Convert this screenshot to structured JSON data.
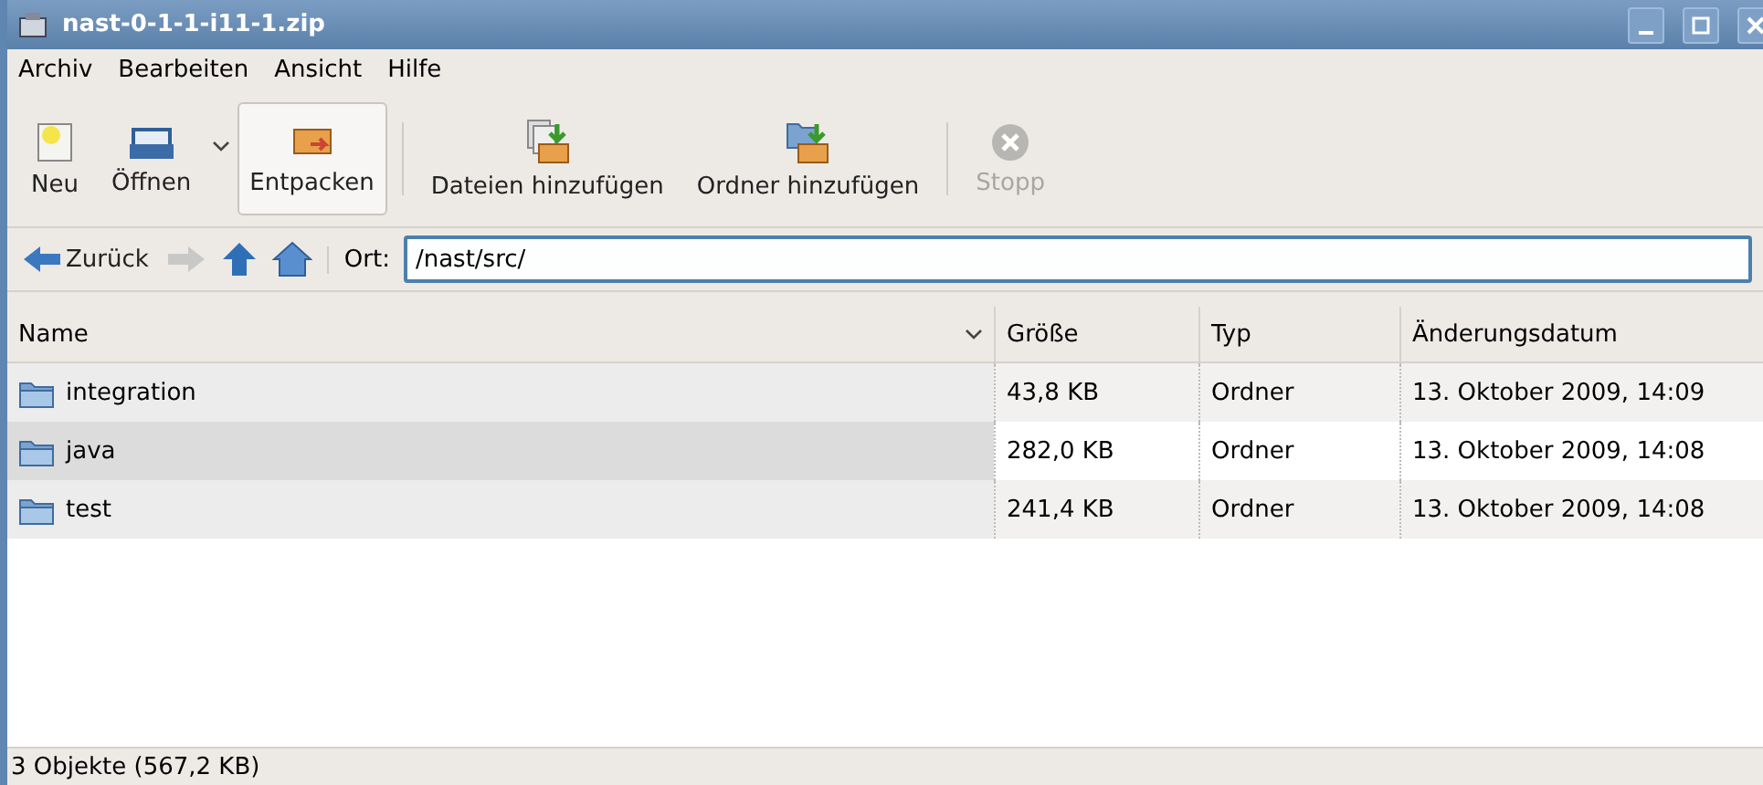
{
  "window": {
    "title": "nast-0-1-1-i11-1.zip"
  },
  "menu": [
    "Archiv",
    "Bearbeiten",
    "Ansicht",
    "Hilfe"
  ],
  "toolbar": [
    {
      "kind": "new",
      "label": "Neu",
      "highlighted": false,
      "disabled": false
    },
    {
      "kind": "open",
      "label": "Öffnen",
      "highlighted": false,
      "disabled": false
    },
    {
      "kind": "extract",
      "label": "Entpacken",
      "highlighted": true,
      "disabled": false
    },
    {
      "kind": "add-files",
      "label": "Dateien hinzufügen",
      "highlighted": false,
      "disabled": false
    },
    {
      "kind": "add-folder",
      "label": "Ordner hinzufügen",
      "highlighted": false,
      "disabled": false
    },
    {
      "kind": "stop",
      "label": "Stopp",
      "highlighted": false,
      "disabled": true
    }
  ],
  "location": {
    "back": "Zurück",
    "label": "Ort:",
    "value": "/nast/src/"
  },
  "table": {
    "columns": [
      "Name",
      "Größe",
      "Typ",
      "Änderungsdatum"
    ],
    "rows": [
      {
        "name": "integration",
        "size": "43,8 KB",
        "type": "Ordner",
        "date": "13. Oktober 2009, 14:09",
        "selected": false
      },
      {
        "name": "java",
        "size": "282,0 KB",
        "type": "Ordner",
        "date": "13. Oktober 2009, 14:08",
        "selected": true
      },
      {
        "name": "test",
        "size": "241,4 KB",
        "type": "Ordner",
        "date": "13. Oktober 2009, 14:08",
        "selected": false
      }
    ]
  },
  "status_bar": "3 Objekte (567,2 KB)"
}
